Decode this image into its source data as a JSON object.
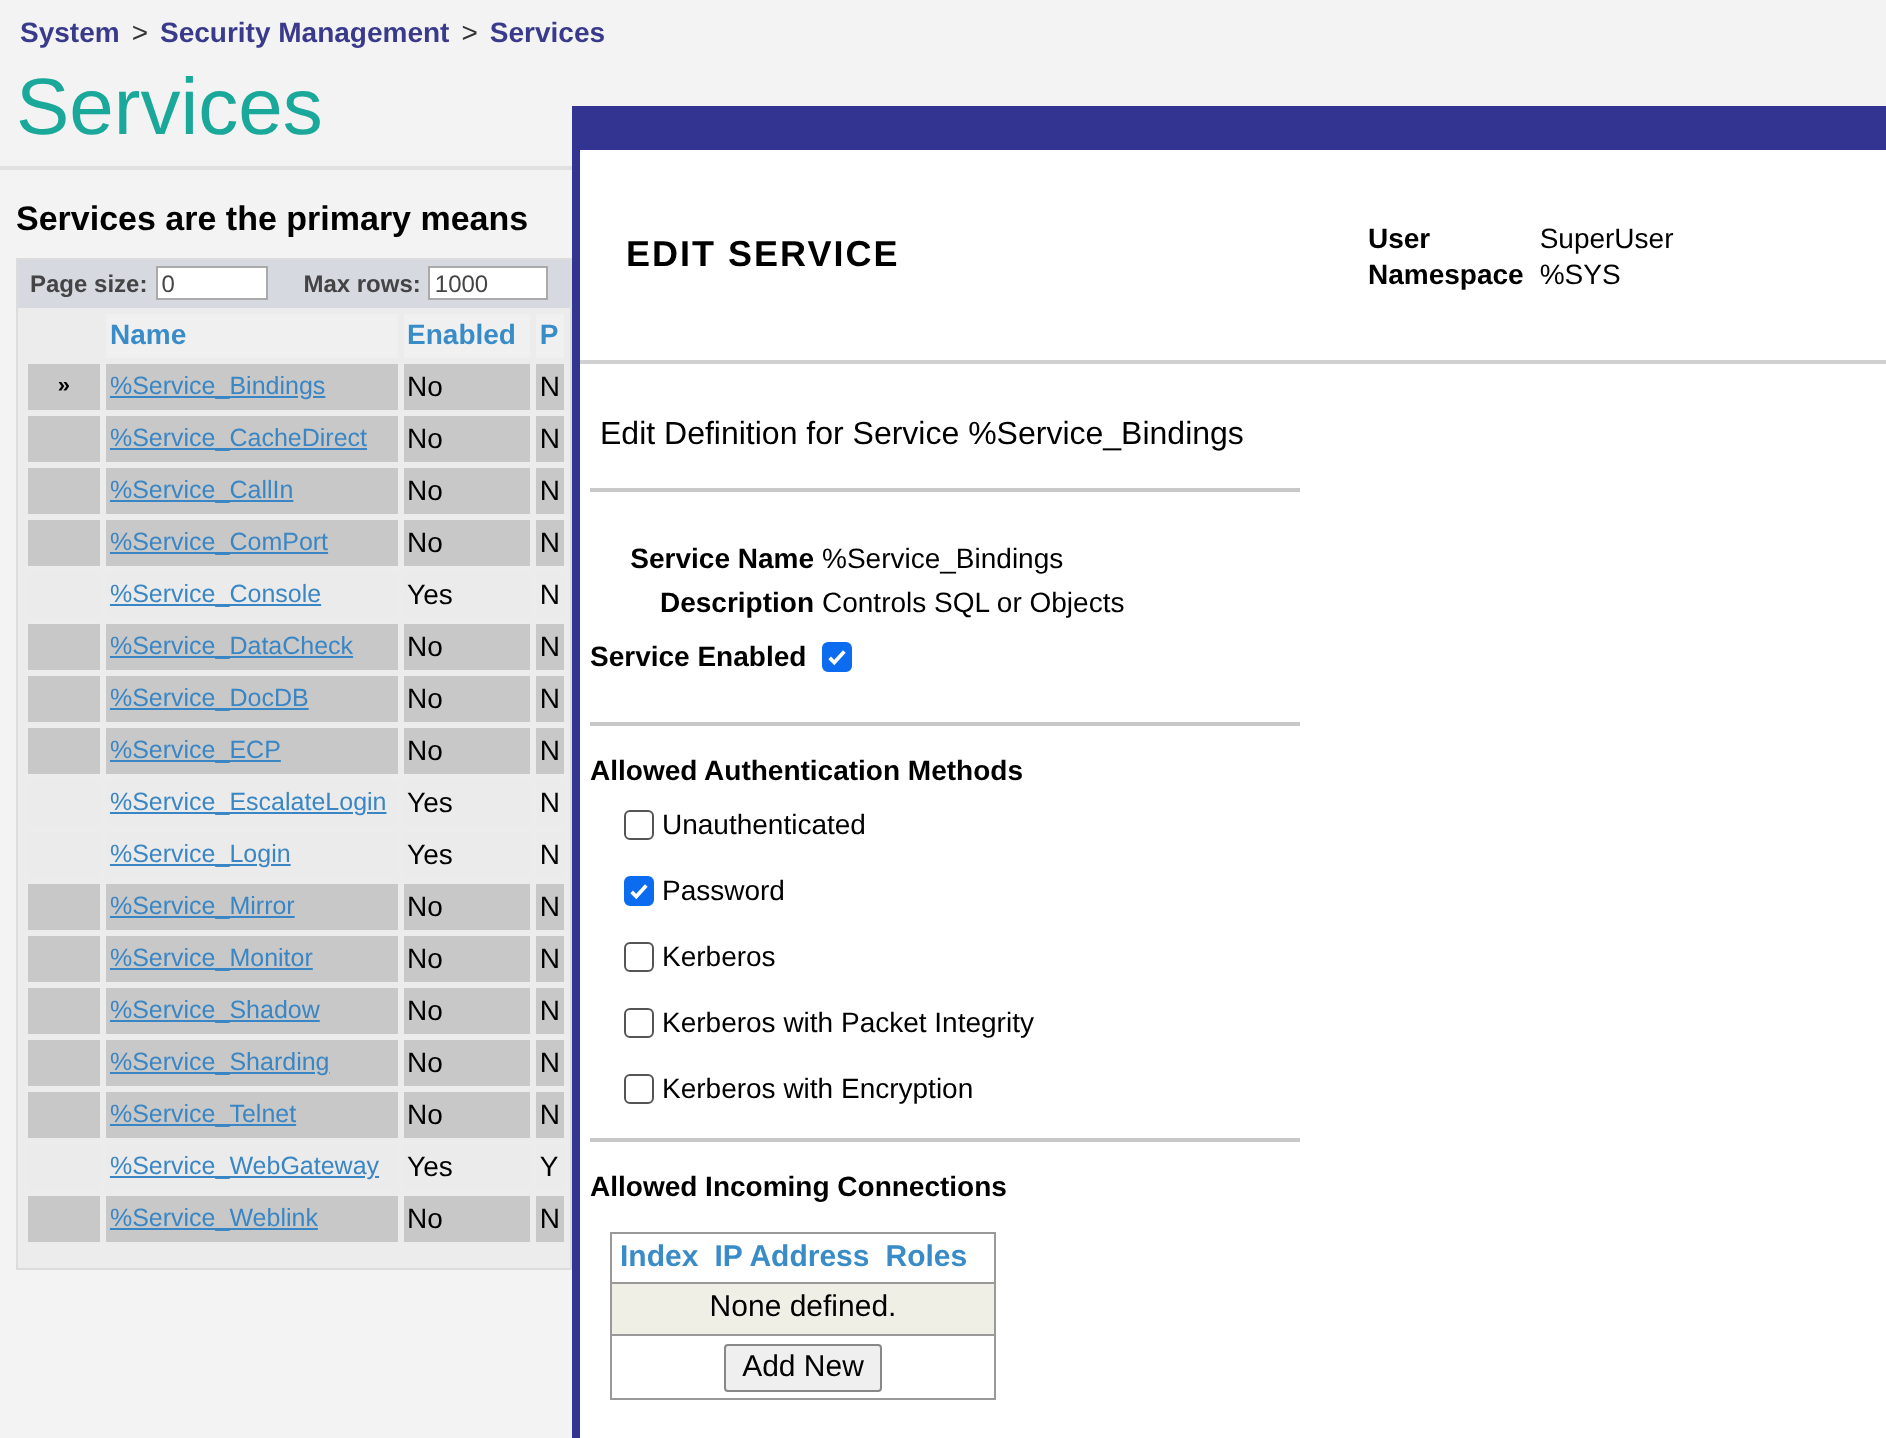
{
  "breadcrumb": [
    "System",
    "Security Management",
    "Services"
  ],
  "breadcrumb_separator": ">",
  "title": "Services",
  "intro": "Services are the primary means",
  "page_size": {
    "label": "Page size:",
    "value": "0"
  },
  "max_rows": {
    "label": "Max rows:",
    "value": "1000"
  },
  "table": {
    "columns": [
      "Name",
      "Enabled",
      "P"
    ],
    "rows": [
      {
        "marker": "»",
        "name": "%Service_Bindings",
        "enabled": "No",
        "column_3": "N",
        "selected": true,
        "shaded": true
      },
      {
        "name": "%Service_CacheDirect",
        "enabled": "No",
        "column_3": "N",
        "selected": false,
        "shaded": true
      },
      {
        "name": "%Service_CallIn",
        "enabled": "No",
        "column_3": "N",
        "selected": false,
        "shaded": true
      },
      {
        "name": "%Service_ComPort",
        "enabled": "No",
        "column_3": "N",
        "selected": false,
        "shaded": true
      },
      {
        "name": "%Service_Console",
        "enabled": "Yes",
        "column_3": "N",
        "selected": false,
        "shaded": false
      },
      {
        "name": "%Service_DataCheck",
        "enabled": "No",
        "column_3": "N",
        "selected": false,
        "shaded": true
      },
      {
        "name": "%Service_DocDB",
        "enabled": "No",
        "column_3": "N",
        "selected": false,
        "shaded": true
      },
      {
        "name": "%Service_ECP",
        "enabled": "No",
        "column_3": "N",
        "selected": false,
        "shaded": true
      },
      {
        "name": "%Service_EscalateLogin",
        "enabled": "Yes",
        "column_3": "N",
        "selected": false,
        "shaded": false
      },
      {
        "name": "%Service_Login",
        "enabled": "Yes",
        "column_3": "N",
        "selected": false,
        "shaded": false
      },
      {
        "name": "%Service_Mirror",
        "enabled": "No",
        "column_3": "N",
        "selected": false,
        "shaded": true
      },
      {
        "name": "%Service_Monitor",
        "enabled": "No",
        "column_3": "N",
        "selected": false,
        "shaded": true
      },
      {
        "name": "%Service_Shadow",
        "enabled": "No",
        "column_3": "N",
        "selected": false,
        "shaded": true
      },
      {
        "name": "%Service_Sharding",
        "enabled": "No",
        "column_3": "N",
        "selected": false,
        "shaded": true
      },
      {
        "name": "%Service_Telnet",
        "enabled": "No",
        "column_3": "N",
        "selected": false,
        "shaded": true
      },
      {
        "name": "%Service_WebGateway",
        "enabled": "Yes",
        "column_3": "Y",
        "selected": false,
        "shaded": false
      },
      {
        "name": "%Service_Weblink",
        "enabled": "No",
        "column_3": "N",
        "selected": false,
        "shaded": true
      }
    ]
  },
  "dialog": {
    "title": "EDIT SERVICE",
    "info": [
      {
        "label": "User",
        "value": "SuperUser"
      },
      {
        "label": "Namespace",
        "value": "%SYS"
      }
    ],
    "subtitle": "Edit Definition for Service %Service_Bindings",
    "fields": [
      {
        "label": "Service Name",
        "value": "%Service_Bindings"
      },
      {
        "label": "Description",
        "value": "Controls SQL or Objects"
      }
    ],
    "service_enabled": {
      "label": "Service Enabled",
      "checked": true
    },
    "auth_heading": "Allowed Authentication Methods",
    "auth_methods": [
      {
        "label": "Unauthenticated",
        "checked": false
      },
      {
        "label": "Password",
        "checked": true
      },
      {
        "label": "Kerberos",
        "checked": false
      },
      {
        "label": "Kerberos with Packet Integrity",
        "checked": false
      },
      {
        "label": "Kerberos with Encryption",
        "checked": false
      }
    ],
    "connections_heading": "Allowed Incoming Connections",
    "connections_table": {
      "columns": [
        "Index",
        "IP Address",
        "Roles"
      ],
      "empty_text": "None defined.",
      "button": "Add New"
    }
  }
}
